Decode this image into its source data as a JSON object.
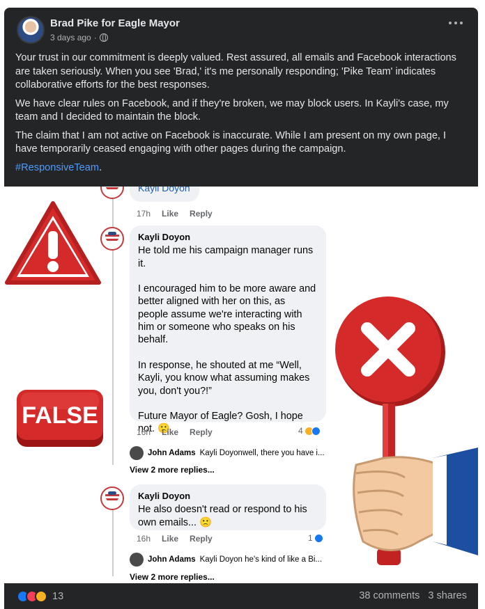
{
  "post": {
    "author": "Brad Pike for Eagle Mayor",
    "time": "3 days ago",
    "separator": "·",
    "paragraphs": [
      "Your trust in our commitment is deeply valued. Rest assured, all emails and Facebook interactions are taken seriously. When you see 'Brad,' it's me personally responding; 'Pike Team' indicates collaborative efforts for the best responses.",
      "We have clear rules on Facebook, and if they're broken, we may block users. In Kayli's case, my team and I decided to maintain the block.",
      "The claim that I am not active on Facebook is inaccurate. While I am present on my own page, I have temporarily ceased engaging with other pages during the campaign."
    ],
    "hashtag": "#ResponsiveTeam",
    "hashtag_suffix": "."
  },
  "image": {
    "comment0": {
      "name_link": "Kayli Doyon",
      "time": "17h",
      "like": "Like",
      "reply": "Reply"
    },
    "comment1": {
      "name": "Kayli Doyon",
      "text": "He told me his campaign manager runs it.\n\nI encouraged him to be more aware and better aligned with her on this, as people assume we're interacting with him or someone who  speaks on his behalf.\n\nIn response, he shouted at me “Well, Kayli, you know what assuming makes you, don't you?!”\n\nFuture Mayor of Eagle? Gosh, I hope not. 🙁",
      "time": "16h",
      "like": "Like",
      "reply": "Reply",
      "reactions": "4"
    },
    "reply1": {
      "name": "John Adams",
      "text": "Kayli Doyonwell, there you have i..."
    },
    "view_more_1": "View 2 more replies...",
    "comment2": {
      "name": "Kayli Doyon",
      "text": "He also doesn't read or respond to his own emails... 🙁",
      "time": "16h",
      "like": "Like",
      "reply": "Reply",
      "reactions": "1"
    },
    "reply2": {
      "name": "John Adams",
      "text": "Kayli Doyon he's kind of like a Bi..."
    },
    "view_more_2": "View 2 more replies...",
    "false_label": "FALSE"
  },
  "footer": {
    "reaction_count": "13",
    "comments": "38 comments",
    "shares": "3 shares"
  },
  "colors": {
    "card_bg": "#242526",
    "text": "#e4e6eb",
    "muted": "#b0b3b8",
    "link": "#4e9bff",
    "warning_red": "#d42a2a"
  }
}
